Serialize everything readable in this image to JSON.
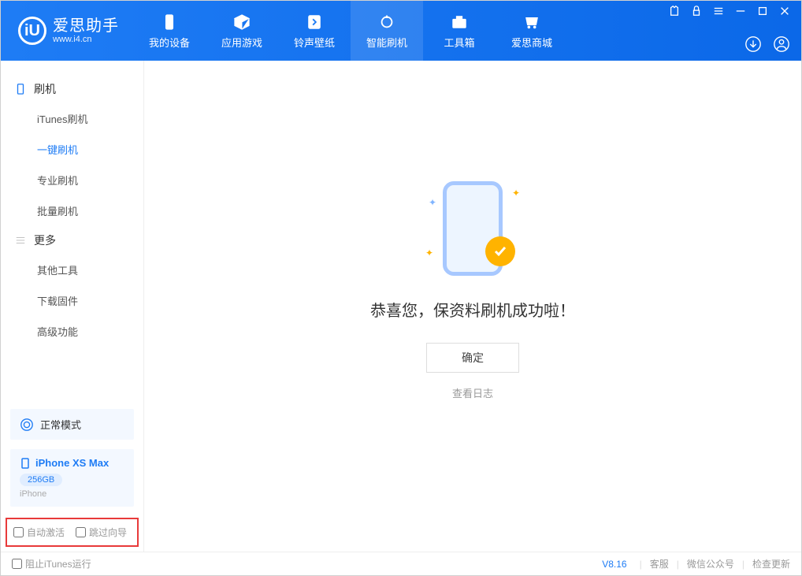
{
  "brand": {
    "name": "爱思助手",
    "site": "www.i4.cn",
    "logo_letter": "iU"
  },
  "nav": [
    {
      "label": "我的设备",
      "icon": "phone"
    },
    {
      "label": "应用游戏",
      "icon": "cube"
    },
    {
      "label": "铃声壁纸",
      "icon": "music"
    },
    {
      "label": "智能刷机",
      "icon": "refresh",
      "active": true
    },
    {
      "label": "工具箱",
      "icon": "toolbox"
    },
    {
      "label": "爱思商城",
      "icon": "cart"
    }
  ],
  "sidebar": {
    "section1": {
      "title": "刷机",
      "items": [
        "iTunes刷机",
        "一键刷机",
        "专业刷机",
        "批量刷机"
      ],
      "active_index": 1
    },
    "section2": {
      "title": "更多",
      "items": [
        "其他工具",
        "下载固件",
        "高级功能"
      ]
    }
  },
  "mode": {
    "label": "正常模式"
  },
  "device": {
    "name": "iPhone XS Max",
    "capacity": "256GB",
    "type": "iPhone"
  },
  "options": {
    "auto_activate": "自动激活",
    "skip_guide": "跳过向导"
  },
  "main": {
    "success_title": "恭喜您，保资料刷机成功啦！",
    "ok_button": "确定",
    "log_link": "查看日志"
  },
  "footer": {
    "block_itunes": "阻止iTunes运行",
    "version": "V8.16",
    "links": [
      "客服",
      "微信公众号",
      "检查更新"
    ]
  }
}
